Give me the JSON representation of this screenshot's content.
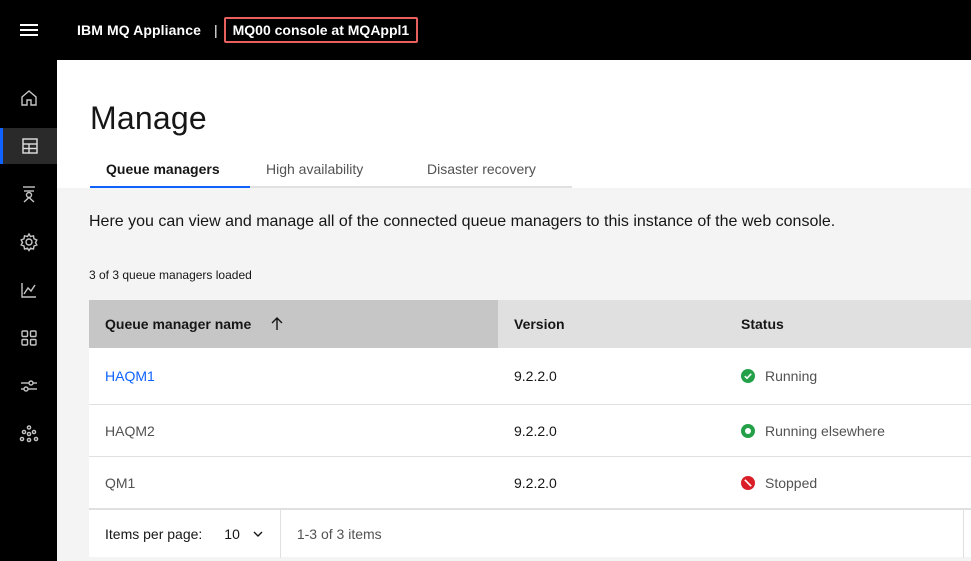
{
  "header": {
    "brand": "IBM MQ Appliance",
    "separator": "|",
    "console_title": "MQ00 console at MQAppl1",
    "menu_icon": "hamburger-menu-icon"
  },
  "sidebar": {
    "items": [
      {
        "icon": "home-icon"
      },
      {
        "icon": "table-icon",
        "active": true
      },
      {
        "icon": "queue-icon"
      },
      {
        "icon": "settings-icon"
      },
      {
        "icon": "chart-icon"
      },
      {
        "icon": "apps-icon"
      },
      {
        "icon": "sliders-icon"
      },
      {
        "icon": "network-icon"
      }
    ]
  },
  "main": {
    "title": "Manage",
    "tabs": [
      {
        "label": "Queue managers",
        "active": true
      },
      {
        "label": "High availability"
      },
      {
        "label": "Disaster recovery"
      }
    ],
    "intro": "Here you can view and manage all of the connected queue managers to this instance of the web console.",
    "loaded_text": "3 of 3 queue managers loaded",
    "table": {
      "columns": [
        "Queue manager name",
        "Version",
        "Status"
      ],
      "rows": [
        {
          "name": "HAQM1",
          "version": "9.2.2.0",
          "status": "Running",
          "status_icon": "running-check-icon"
        },
        {
          "name": "HAQM2",
          "version": "9.2.2.0",
          "status": "Running elsewhere",
          "status_icon": "running-elsewhere-icon"
        },
        {
          "name": "QM1",
          "version": "9.2.2.0",
          "status": "Stopped",
          "status_icon": "stopped-icon"
        }
      ]
    },
    "pagination": {
      "items_per_page_label": "Items per page:",
      "items_per_page_value": "10",
      "range_text": "1-3 of 3 items"
    }
  },
  "colors": {
    "accent": "#0f62fe",
    "running": "#24a148",
    "stopped": "#da1e28",
    "highlight_border": "#e8605e"
  }
}
